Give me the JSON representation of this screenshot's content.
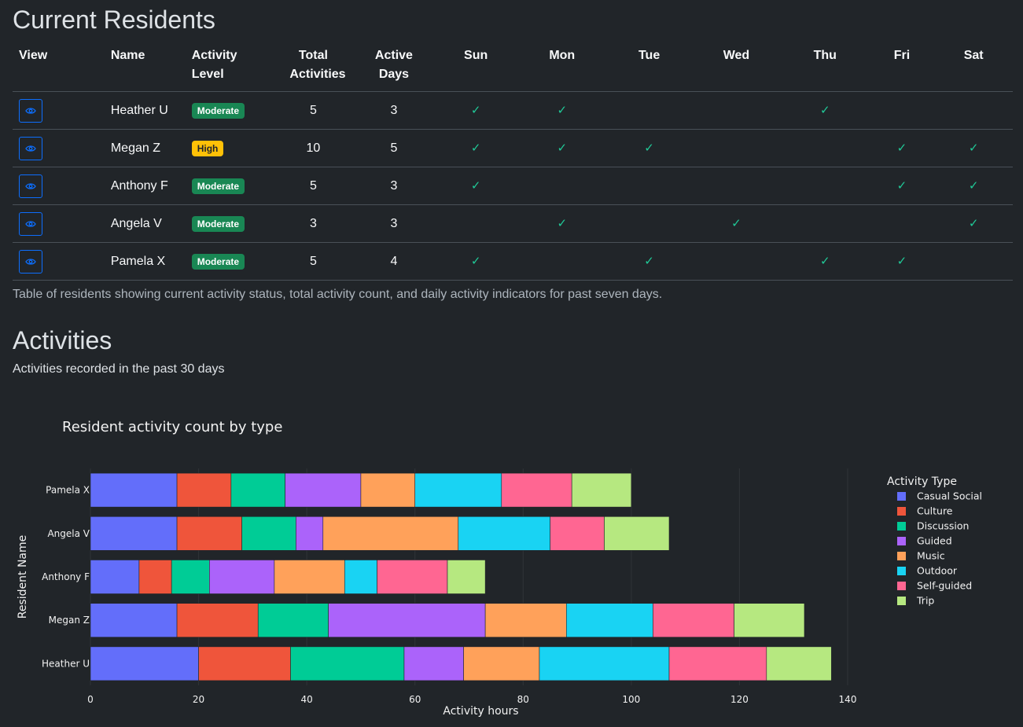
{
  "residents": {
    "title": "Current Residents",
    "columns": [
      "View",
      "Name",
      "Activity Level",
      "Total Activities",
      "Active Days",
      "Sun",
      "Mon",
      "Tue",
      "Wed",
      "Thu",
      "Fri",
      "Sat"
    ],
    "rows": [
      {
        "name": "Heather U",
        "level": "Moderate",
        "total": "5",
        "active_days": "3",
        "days": [
          true,
          true,
          false,
          false,
          true,
          false,
          false
        ]
      },
      {
        "name": "Megan Z",
        "level": "High",
        "total": "10",
        "active_days": "5",
        "days": [
          true,
          true,
          true,
          false,
          false,
          true,
          true
        ]
      },
      {
        "name": "Anthony F",
        "level": "Moderate",
        "total": "5",
        "active_days": "3",
        "days": [
          true,
          false,
          false,
          false,
          false,
          true,
          true
        ]
      },
      {
        "name": "Angela V",
        "level": "Moderate",
        "total": "3",
        "active_days": "3",
        "days": [
          false,
          true,
          false,
          true,
          false,
          false,
          true
        ]
      },
      {
        "name": "Pamela X",
        "level": "Moderate",
        "total": "5",
        "active_days": "4",
        "days": [
          true,
          false,
          true,
          false,
          true,
          true,
          false
        ]
      }
    ],
    "caption": "Table of residents showing current activity status, total activity count, and daily activity indicators for past seven days.",
    "check_glyph": "✓",
    "view_icon": "eye-icon"
  },
  "activities": {
    "title": "Activities",
    "subtitle": "Activities recorded in the past 30 days"
  },
  "colors": {
    "background": "#212529",
    "badge_moderate": "#198754",
    "badge_high": "#ffc107",
    "check": "#20c997",
    "button": "#0d6efd"
  },
  "chart_data": {
    "type": "bar",
    "orientation": "horizontal",
    "stacked": true,
    "title": "Resident activity count by type",
    "xlabel": "Activity hours",
    "ylabel": "Resident Name",
    "xlim": [
      0,
      140
    ],
    "xticks": [
      0,
      20,
      40,
      60,
      80,
      100,
      120,
      140
    ],
    "grid": true,
    "legend_title": "Activity Type",
    "legend_position": "right",
    "categories": [
      "Heather U",
      "Megan Z",
      "Anthony F",
      "Angela V",
      "Pamela X"
    ],
    "series": [
      {
        "name": "Casual Social",
        "color": "#636efa",
        "values": [
          20,
          16,
          9,
          16,
          16
        ]
      },
      {
        "name": "Culture",
        "color": "#ef553b",
        "values": [
          17,
          15,
          6,
          12,
          10
        ]
      },
      {
        "name": "Discussion",
        "color": "#00cc96",
        "values": [
          21,
          13,
          7,
          10,
          10
        ]
      },
      {
        "name": "Guided",
        "color": "#ab63fa",
        "values": [
          11,
          29,
          12,
          5,
          14
        ]
      },
      {
        "name": "Music",
        "color": "#ffa15a",
        "values": [
          14,
          15,
          13,
          25,
          10
        ]
      },
      {
        "name": "Outdoor",
        "color": "#19d3f3",
        "values": [
          24,
          16,
          6,
          17,
          16
        ]
      },
      {
        "name": "Self-guided",
        "color": "#ff6692",
        "values": [
          18,
          15,
          13,
          10,
          13
        ]
      },
      {
        "name": "Trip",
        "color": "#b6e880",
        "values": [
          12,
          13,
          7,
          12,
          11
        ]
      }
    ]
  }
}
